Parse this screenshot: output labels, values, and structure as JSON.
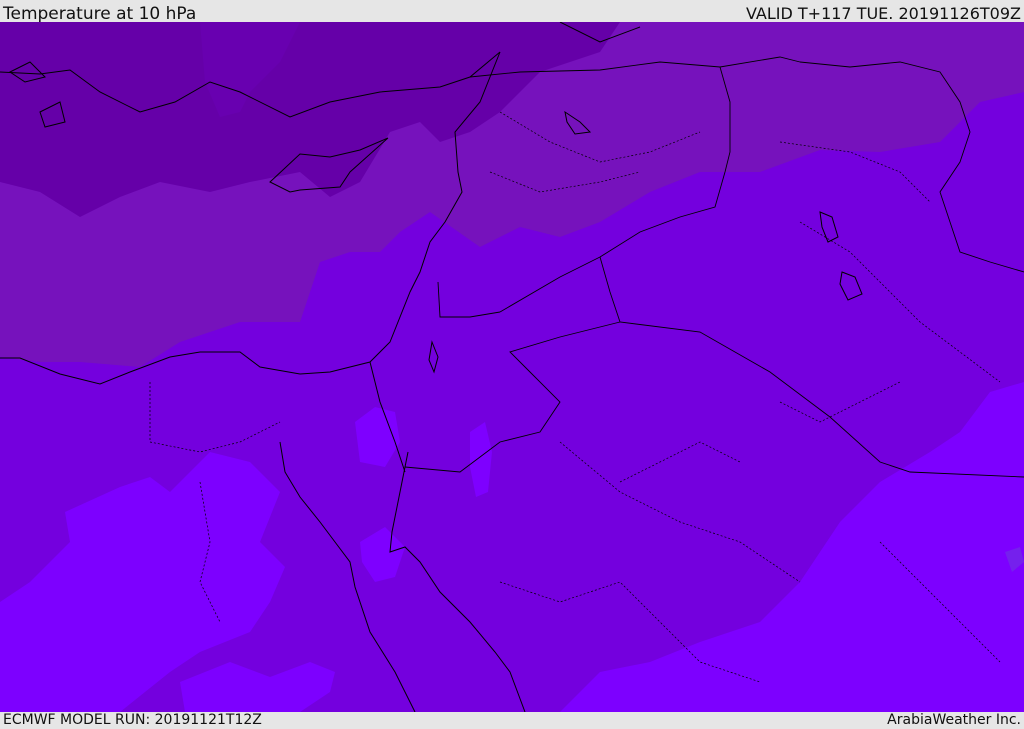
{
  "header": {
    "title": "Temperature at 10 hPa",
    "valid": "VALID T+117 TUE. 20191126T09Z"
  },
  "footer": {
    "model_run": "ECMWF MODEL RUN: 20191121T12Z",
    "credit": "ArabiaWeather Inc."
  },
  "map": {
    "field": "temperature",
    "level": "10 hPa",
    "colors": {
      "coldest": "#6400a8",
      "cold": "#7511ba",
      "mid": "#7a00e0",
      "warm": "#7300f2",
      "warmest": "#7e00ff",
      "coast": "#000000"
    }
  }
}
